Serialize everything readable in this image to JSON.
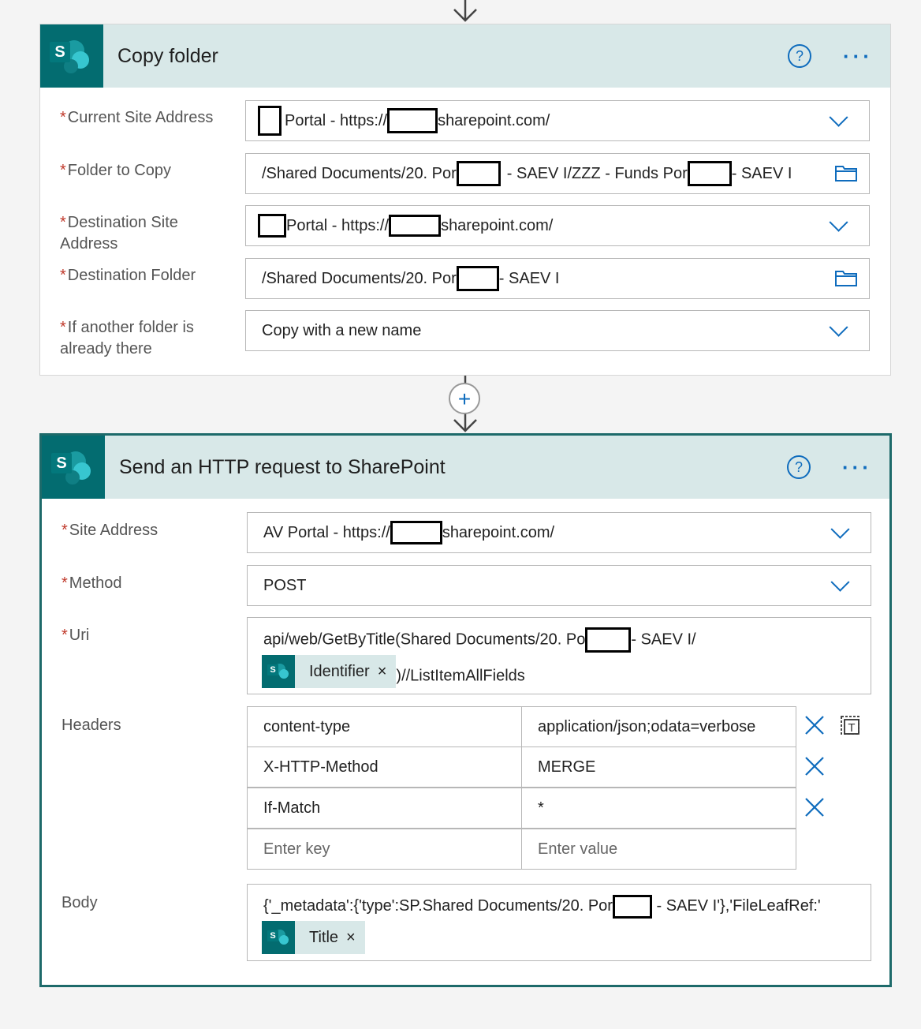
{
  "copy_folder": {
    "title": "Copy folder",
    "fields": [
      {
        "label": "Current Site Address",
        "required": true,
        "value_pre": "",
        "value_mid": "Portal - https://",
        "value_post": "sharepoint.com/"
      },
      {
        "label": "Folder to Copy",
        "required": true,
        "value_pre": "/Shared Documents/20. Por",
        "value_mid": "- SAEV I/ZZZ - Funds Por",
        "value_post": "- SAEV I"
      },
      {
        "label_line1": "Destination Site",
        "label_line2": "Address",
        "required": true,
        "value_mid": "Portal - https://",
        "value_post": "sharepoint.com/"
      },
      {
        "label": "Destination Folder",
        "required": true,
        "value_pre": "/Shared Documents/20. Por",
        "value_post": "- SAEV I"
      },
      {
        "label_line1": "If another folder is",
        "label_line2": "already there",
        "required": true,
        "value": "Copy with a new name"
      }
    ]
  },
  "http_request": {
    "title": "Send an HTTP request to SharePoint",
    "site_address": {
      "label": "Site Address",
      "value_pre": "AV Portal - https://",
      "value_post": "sharepoint.com/"
    },
    "method": {
      "label": "Method",
      "value": "POST"
    },
    "uri": {
      "label": "Uri",
      "line1_pre": "api/web/GetByTitle(Shared Documents/20. Po",
      "line1_post": "- SAEV I/",
      "token": "Identifier",
      "line2_post": ")//ListItemAllFields"
    },
    "headers": {
      "label": "Headers",
      "rows": [
        {
          "key": "content-type",
          "value": "application/json;odata=verbose"
        },
        {
          "key": "X-HTTP-Method",
          "value": "MERGE"
        },
        {
          "key": "If-Match",
          "value": "*"
        }
      ],
      "key_placeholder": "Enter key",
      "value_placeholder": "Enter value"
    },
    "body": {
      "label": "Body",
      "line1_pre": "{'_metadata':{'type':SP.Shared Documents/20. Por",
      "line1_post": "- SAEV I'},'FileLeafRef:'",
      "token": "Title"
    }
  },
  "required_mark": "*",
  "token_close": "×",
  "colors": {
    "accent": "#0f6cbd",
    "header_bg": "#d8e8e8",
    "sharepoint": "#036c70",
    "selected_border": "#1d6a6a"
  }
}
